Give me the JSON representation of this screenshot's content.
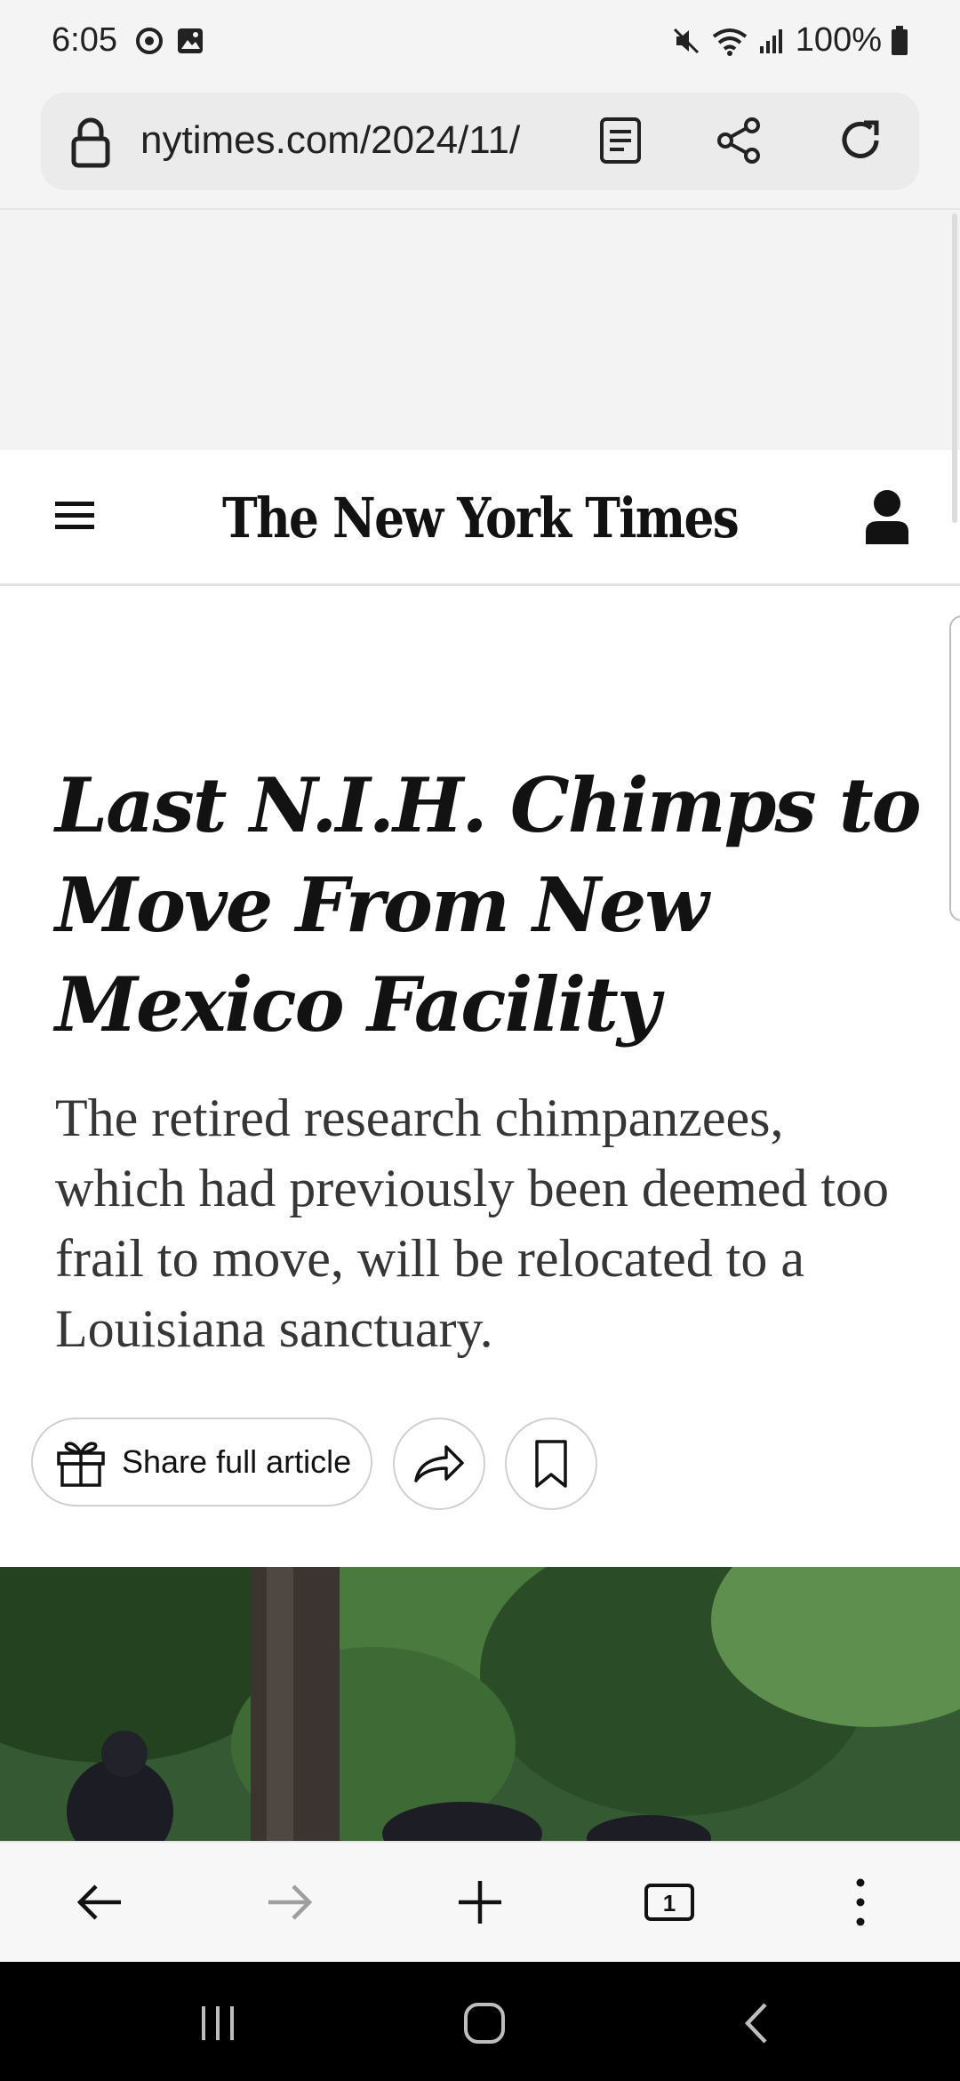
{
  "status_bar": {
    "time": "6:05",
    "battery": "100%"
  },
  "browser": {
    "url": "nytimes.com/2024/11/",
    "tab_count": "1"
  },
  "site": {
    "masthead": "The New York Times"
  },
  "article": {
    "headline": "Last N.I.H. Chimps to Move From New Mexico Facility",
    "summary": "The retired research chimpanzees, which had previously been deemed too frail to move, will be relocated to a Louisiana sanctuary.",
    "share_full_label": "Share full article"
  },
  "colors": {
    "text": "#121212",
    "summary": "#363636",
    "border": "#d0d0d0",
    "browser_chrome": "#f4f4f4"
  }
}
